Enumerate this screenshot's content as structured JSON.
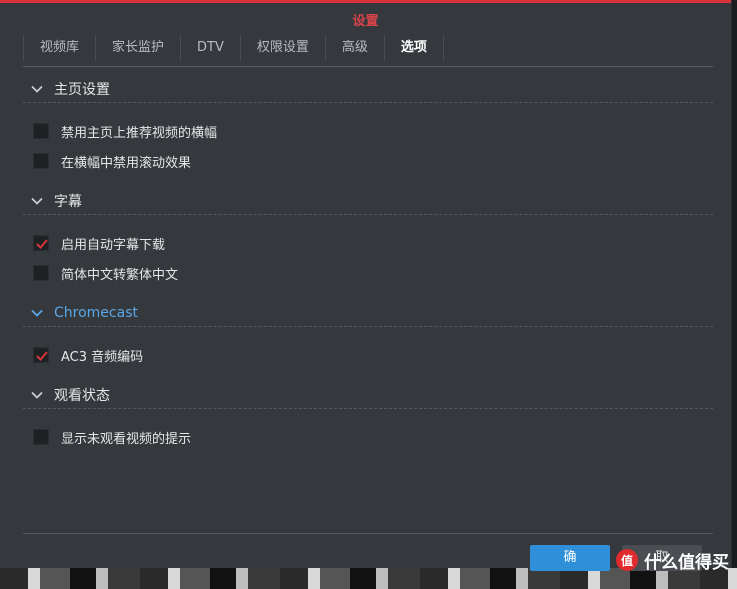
{
  "dialog": {
    "title": "设置",
    "accent": "#d8353a",
    "tabs": [
      {
        "label": "视频库",
        "active": false
      },
      {
        "label": "家长监护",
        "active": false
      },
      {
        "label": "DTV",
        "active": false
      },
      {
        "label": "权限设置",
        "active": false
      },
      {
        "label": "高级",
        "active": false
      },
      {
        "label": "选项",
        "active": true
      }
    ]
  },
  "sections": [
    {
      "title": "主页设置",
      "options": [
        {
          "label": "禁用主页上推荐视频的横幅",
          "checked": false
        },
        {
          "label": "在横幅中禁用滚动效果",
          "checked": false
        }
      ]
    },
    {
      "title": "字幕",
      "options": [
        {
          "label": "启用自动字幕下载",
          "checked": true
        },
        {
          "label": "简体中文转繁体中文",
          "checked": false
        }
      ]
    },
    {
      "title": "Chromecast",
      "title_color": "#5aa6e6",
      "options": [
        {
          "label": "AC3 音频编码",
          "checked": true
        }
      ]
    },
    {
      "title": "观看状态",
      "options": [
        {
          "label": "显示未观看视频的提示",
          "checked": false
        }
      ]
    }
  ],
  "footer": {
    "ok_label": "确",
    "cancel_label": "取"
  },
  "watermark": {
    "badge": "值",
    "text": "什么值得买"
  },
  "colors": {
    "checkmark": "#d8353a",
    "primary_button": "#2f8fd8"
  }
}
